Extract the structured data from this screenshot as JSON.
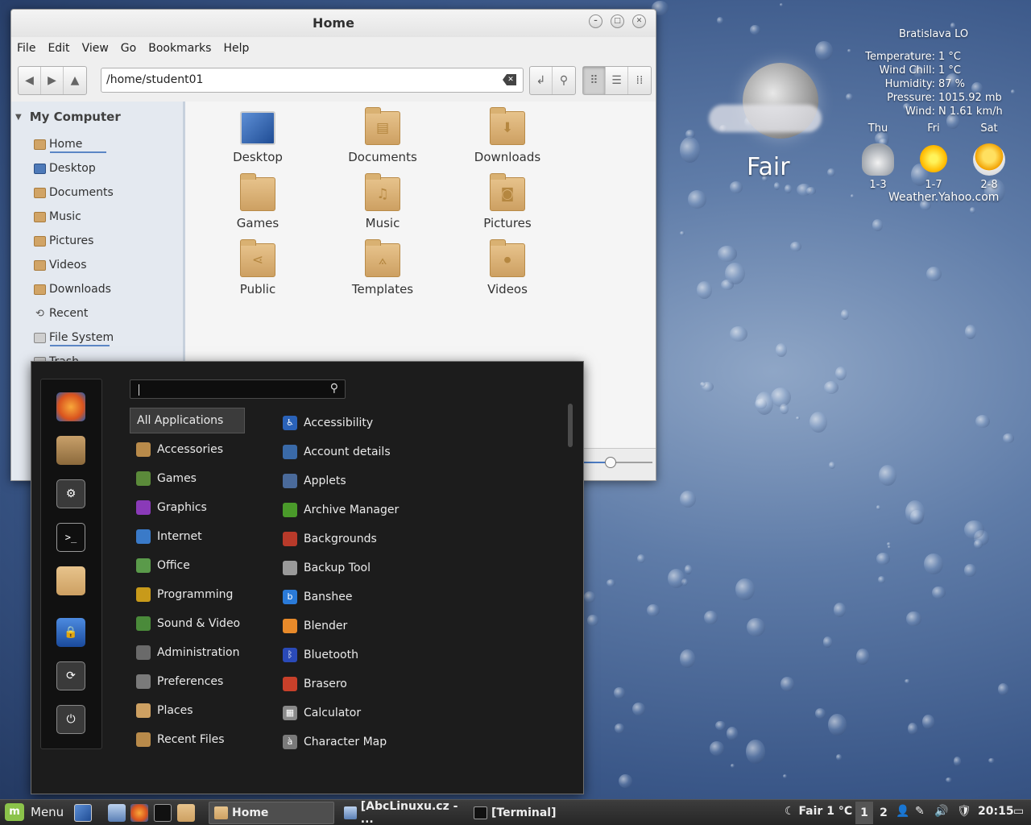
{
  "weather": {
    "city": "Bratislava LO",
    "details": [
      {
        "label": "Temperature:",
        "value": "1  °C"
      },
      {
        "label": "Wind Chill:",
        "value": "1 °C"
      },
      {
        "label": "Humidity:",
        "value": "87 %"
      },
      {
        "label": "Pressure:",
        "value": "1015.92 mb"
      },
      {
        "label": "Wind:",
        "value": "N 1.61 km/h"
      }
    ],
    "condition": "Fair",
    "forecast": [
      {
        "day": "Thu",
        "range": "1-3",
        "icon": "cloudy-icon"
      },
      {
        "day": "Fri",
        "range": "1-7",
        "icon": "sunny-icon"
      },
      {
        "day": "Sat",
        "range": "2-8",
        "icon": "partly-sunny-icon"
      }
    ],
    "source": "Weather.Yahoo.com"
  },
  "window": {
    "title": "Home",
    "menu": [
      "File",
      "Edit",
      "View",
      "Go",
      "Bookmarks",
      "Help"
    ],
    "location": "/home/student01",
    "sidebar": {
      "header": "My Computer",
      "items": [
        {
          "label": "Home",
          "icon": "home-folder-icon"
        },
        {
          "label": "Desktop",
          "icon": "desktop-icon"
        },
        {
          "label": "Documents",
          "icon": "documents-folder-icon"
        },
        {
          "label": "Music",
          "icon": "music-folder-icon"
        },
        {
          "label": "Pictures",
          "icon": "pictures-folder-icon"
        },
        {
          "label": "Videos",
          "icon": "videos-folder-icon"
        },
        {
          "label": "Downloads",
          "icon": "downloads-folder-icon"
        },
        {
          "label": "Recent",
          "icon": "recent-icon"
        },
        {
          "label": "File System",
          "icon": "drive-icon"
        },
        {
          "label": "Trash",
          "icon": "trash-icon"
        }
      ]
    },
    "files": [
      {
        "label": "Desktop",
        "icon": "desktop-icon"
      },
      {
        "label": "Documents",
        "icon": "documents-folder-icon"
      },
      {
        "label": "Downloads",
        "icon": "downloads-folder-icon"
      },
      {
        "label": "Games",
        "icon": "folder-icon"
      },
      {
        "label": "Music",
        "icon": "music-folder-icon"
      },
      {
        "label": "Pictures",
        "icon": "pictures-folder-icon"
      },
      {
        "label": "Public",
        "icon": "public-folder-icon"
      },
      {
        "label": "Templates",
        "icon": "templates-folder-icon"
      },
      {
        "label": "Videos",
        "icon": "videos-folder-icon"
      }
    ],
    "zoom_level": 0.4
  },
  "menu": {
    "favorites": [
      "firefox-icon",
      "software-manager-icon",
      "system-settings-icon",
      "terminal-icon",
      "files-icon",
      "lock-screen-icon",
      "logout-icon",
      "power-icon"
    ],
    "categories": [
      {
        "label": "All Applications",
        "icon": ""
      },
      {
        "label": "Accessories",
        "icon": "accessories-icon"
      },
      {
        "label": "Games",
        "icon": "games-icon"
      },
      {
        "label": "Graphics",
        "icon": "graphics-icon"
      },
      {
        "label": "Internet",
        "icon": "internet-icon"
      },
      {
        "label": "Office",
        "icon": "office-icon"
      },
      {
        "label": "Programming",
        "icon": "programming-icon"
      },
      {
        "label": "Sound & Video",
        "icon": "sound-video-icon"
      },
      {
        "label": "Administration",
        "icon": "administration-icon"
      },
      {
        "label": "Preferences",
        "icon": "preferences-icon"
      },
      {
        "label": "Places",
        "icon": "places-icon"
      },
      {
        "label": "Recent Files",
        "icon": "recent-files-icon"
      }
    ],
    "apps": [
      {
        "label": "Accessibility",
        "icon": "accessibility-icon"
      },
      {
        "label": "Account details",
        "icon": "account-icon"
      },
      {
        "label": "Applets",
        "icon": "applets-icon"
      },
      {
        "label": "Archive Manager",
        "icon": "archive-icon"
      },
      {
        "label": "Backgrounds",
        "icon": "backgrounds-icon"
      },
      {
        "label": "Backup Tool",
        "icon": "backup-icon"
      },
      {
        "label": "Banshee",
        "icon": "banshee-icon"
      },
      {
        "label": "Blender",
        "icon": "blender-icon"
      },
      {
        "label": "Bluetooth",
        "icon": "bluetooth-icon"
      },
      {
        "label": "Brasero",
        "icon": "brasero-icon"
      },
      {
        "label": "Calculator",
        "icon": "calculator-icon"
      },
      {
        "label": "Character Map",
        "icon": "character-map-icon"
      }
    ]
  },
  "panel": {
    "menu_label": "Menu",
    "tasks": [
      {
        "label": "Home",
        "icon": "folder-icon"
      },
      {
        "label": "[AbcLinuxu.cz - ...",
        "icon": "browser-icon"
      },
      {
        "label": "[Terminal]",
        "icon": "terminal-icon"
      }
    ],
    "weather": "Fair 1 °C",
    "workspaces": [
      "1",
      "2"
    ],
    "clock": "20:15"
  }
}
